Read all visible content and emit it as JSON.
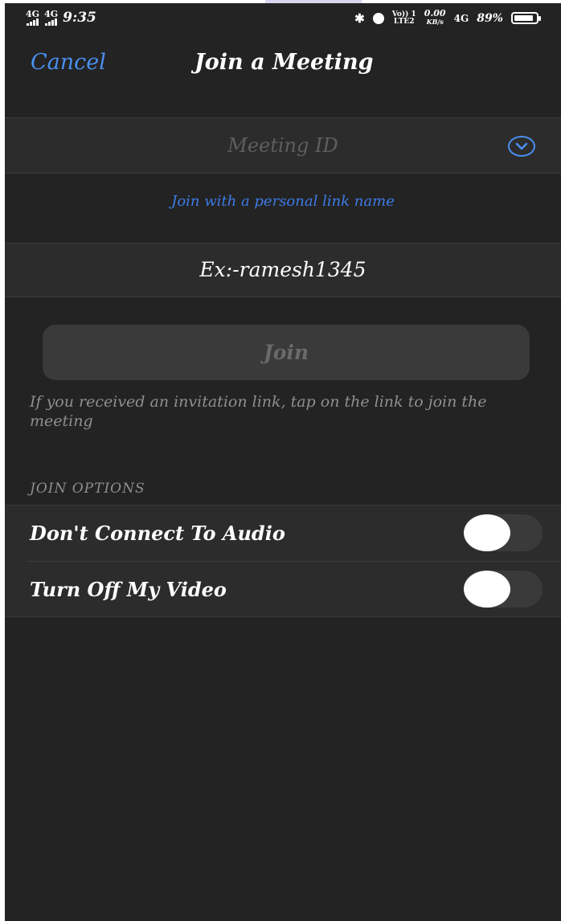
{
  "status_bar": {
    "network_1": "4G",
    "network_2": "4G",
    "time": "9:35",
    "volte": "Vo)) 1",
    "lte": "LTE2",
    "speed_value": "0.00",
    "speed_unit": "KB/s",
    "network_3": "4G",
    "battery_percent": "89%",
    "battery_level": 0.89
  },
  "nav": {
    "cancel_label": "Cancel",
    "title": "Join a Meeting"
  },
  "meeting_id": {
    "placeholder": "Meeting ID",
    "dropdown_icon": "chevron-down-circle-icon"
  },
  "personal_link_label": "Join with a personal link name",
  "name_field": {
    "value": "Ex:-ramesh1345"
  },
  "join_button": {
    "label": "Join"
  },
  "hint_text": "If you received an invitation link, tap on the link to join the meeting",
  "join_options": {
    "title": "JOIN OPTIONS",
    "items": [
      {
        "label": "Don't Connect To Audio",
        "enabled": false
      },
      {
        "label": "Turn Off My Video",
        "enabled": false
      }
    ]
  },
  "colors": {
    "background": "#232323",
    "accent": "#4a8ff0",
    "link": "#3d7be8"
  }
}
